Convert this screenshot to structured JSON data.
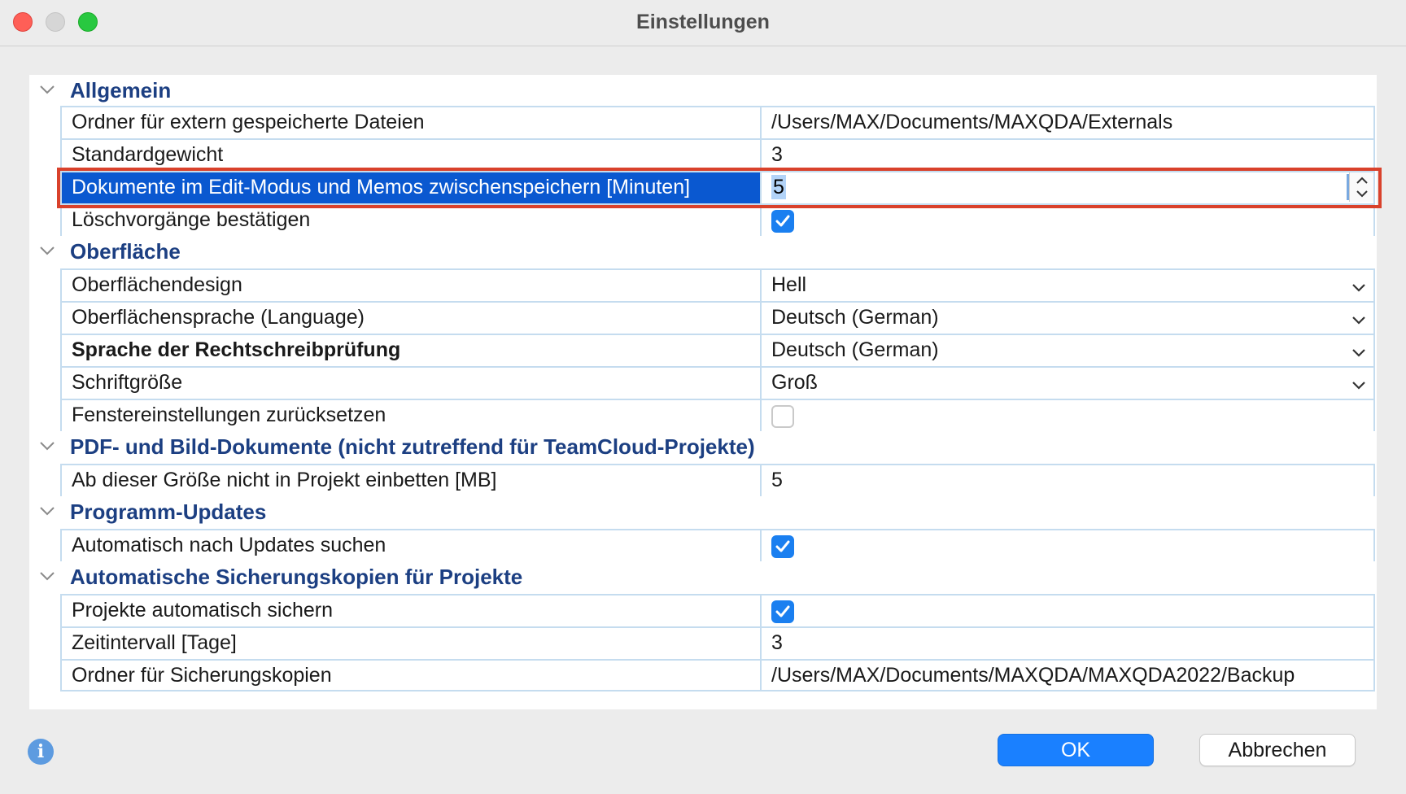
{
  "window": {
    "title": "Einstellungen"
  },
  "sections": {
    "allgemein": {
      "label": "Allgemein",
      "rows": [
        {
          "label": "Ordner für extern gespeicherte Dateien",
          "value": "/Users/MAX/Documents/MAXQDA/Externals"
        },
        {
          "label": "Standardgewicht",
          "value": "3"
        },
        {
          "label": "Dokumente im Edit-Modus und Memos zwischenspeichern [Minuten]",
          "value": "5"
        },
        {
          "label": "Löschvorgänge bestätigen",
          "checked": true
        }
      ]
    },
    "oberflaeche": {
      "label": "Oberfläche",
      "rows": [
        {
          "label": "Oberflächendesign",
          "value": "Hell"
        },
        {
          "label": "Oberflächensprache (Language)",
          "value": "Deutsch (German)"
        },
        {
          "label": "Sprache der Rechtschreibprüfung",
          "value": "Deutsch (German)"
        },
        {
          "label": "Schriftgröße",
          "value": "Groß"
        },
        {
          "label": "Fenstereinstellungen zurücksetzen",
          "checked": false
        }
      ]
    },
    "pdf": {
      "label": "PDF- und Bild-Dokumente (nicht zutreffend für TeamCloud-Projekte)",
      "rows": [
        {
          "label": "Ab dieser Größe nicht in Projekt einbetten [MB]",
          "value": "5"
        }
      ]
    },
    "updates": {
      "label": "Programm-Updates",
      "rows": [
        {
          "label": "Automatisch nach Updates suchen",
          "checked": true
        }
      ]
    },
    "backup": {
      "label": "Automatische Sicherungskopien für Projekte",
      "rows": [
        {
          "label": "Projekte automatisch sichern",
          "checked": true
        },
        {
          "label": "Zeitintervall [Tage]",
          "value": "3"
        },
        {
          "label": "Ordner für Sicherungskopien",
          "value": "/Users/MAX/Documents/MAXQDA/MAXQDA2022/Backup"
        }
      ]
    }
  },
  "buttons": {
    "ok": "OK",
    "cancel": "Abbrechen"
  },
  "icons": {
    "info": "i"
  },
  "colors": {
    "section_label": "#1c3f82",
    "selection": "#0a58d0",
    "checkbox_on": "#1a7ff0",
    "highlight_frame": "#d9412b",
    "ok_button": "#1a80ff"
  }
}
